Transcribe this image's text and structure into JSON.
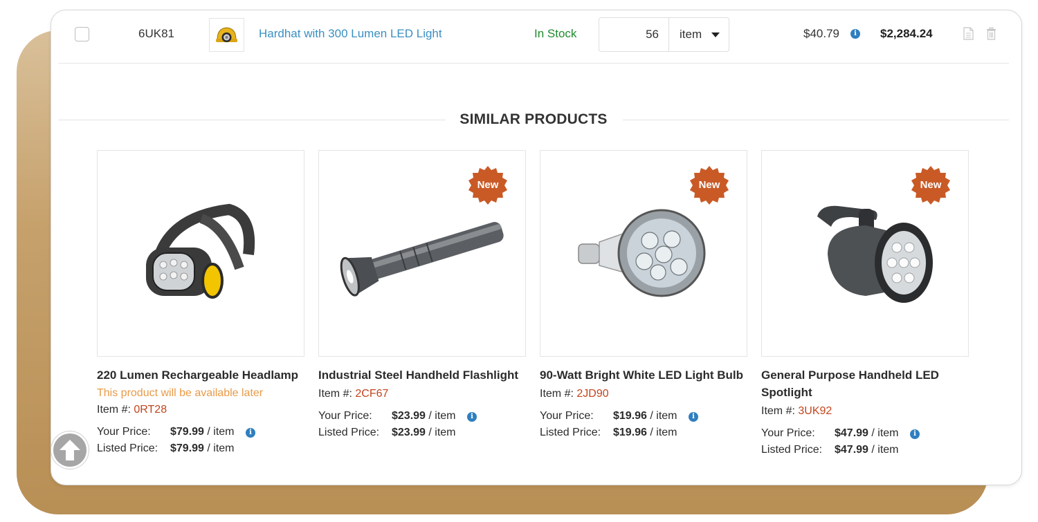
{
  "cart": {
    "sku": "6UK81",
    "product_name": "Hardhat with 300 Lumen LED Light",
    "stock_status": "In Stock",
    "quantity": "56",
    "unit": "item",
    "unit_price": "$40.79",
    "total": "$2,284.24"
  },
  "section_title": "SIMILAR PRODUCTS",
  "products": [
    {
      "title": "220 Lumen Rechargeable Headlamp",
      "availability": "This product will be available later",
      "item_label": "Item #:",
      "item_code": "0RT28",
      "your_price_label": "Your Price:",
      "your_price": "$79.99",
      "listed_price_label": "Listed Price:",
      "listed_price": "$79.99",
      "per_unit": "/ item",
      "is_new": false
    },
    {
      "title": "Industrial Steel Handheld Flashlight",
      "availability": "",
      "item_label": "Item #:",
      "item_code": "2CF67",
      "your_price_label": "Your Price:",
      "your_price": "$23.99",
      "listed_price_label": "Listed Price:",
      "listed_price": "$23.99",
      "per_unit": "/ item",
      "is_new": true,
      "badge": "New"
    },
    {
      "title": "90-Watt Bright White LED Light Bulb",
      "availability": "",
      "item_label": "Item #:",
      "item_code": "2JD90",
      "your_price_label": "Your Price:",
      "your_price": "$19.96",
      "listed_price_label": "Listed Price:",
      "listed_price": "$19.96",
      "per_unit": "/ item",
      "is_new": true,
      "badge": "New"
    },
    {
      "title": "General Purpose Handheld LED Spotlight",
      "availability": "",
      "item_label": "Item #:",
      "item_code": "3UK92",
      "your_price_label": "Your Price:",
      "your_price": "$47.99",
      "listed_price_label": "Listed Price:",
      "listed_price": "$47.99",
      "per_unit": "/ item",
      "is_new": true,
      "badge": "New"
    }
  ],
  "colors": {
    "link": "#3a8fc2",
    "in_stock": "#1f8a2e",
    "item_code": "#c2441c",
    "availability": "#e99a47",
    "badge": "#c95a26",
    "backdrop": "#c6a16c"
  },
  "icons": {
    "info": "info-circle-icon",
    "document": "document-icon",
    "trash": "trash-icon",
    "scroll_top": "arrow-up-icon"
  }
}
